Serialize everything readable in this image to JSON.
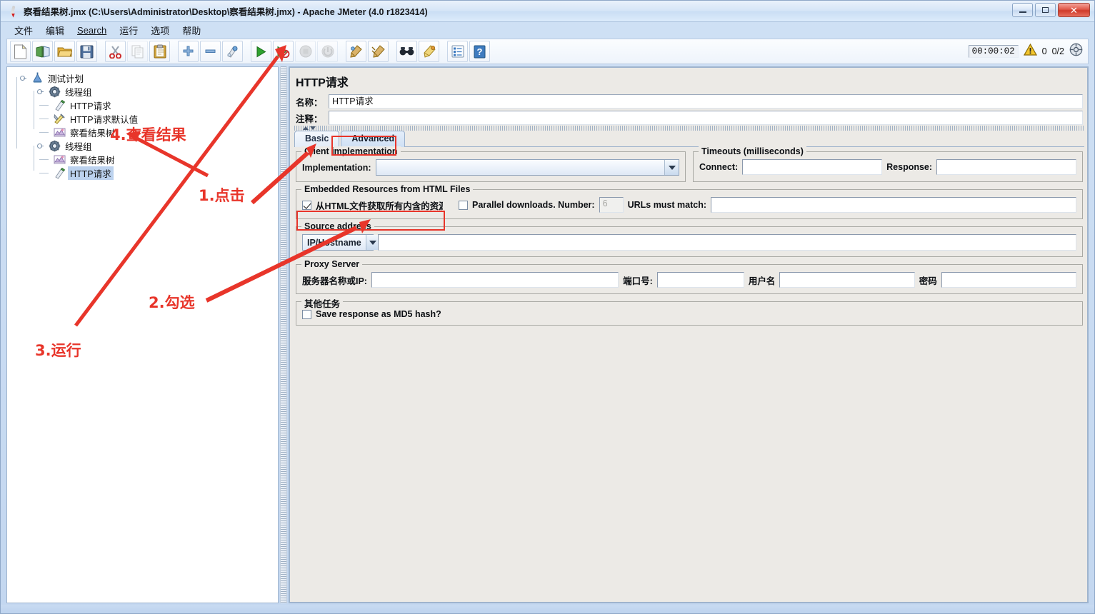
{
  "window": {
    "title": "察看结果树.jmx (C:\\Users\\Administrator\\Desktop\\察看结果树.jmx) - Apache JMeter (4.0 r1823414)",
    "icon": "jmeter-feather-icon",
    "controls": {
      "minimize": "–",
      "maximize": "□",
      "close": "✕"
    }
  },
  "menubar": {
    "items": [
      {
        "label": "文件",
        "name": "menu-file"
      },
      {
        "label": "编辑",
        "name": "menu-edit"
      },
      {
        "label": "Search",
        "name": "menu-search"
      },
      {
        "label": "运行",
        "name": "menu-run"
      },
      {
        "label": "选项",
        "name": "menu-options"
      },
      {
        "label": "帮助",
        "name": "menu-help"
      }
    ]
  },
  "toolbar": {
    "buttons": [
      {
        "name": "new-icon",
        "title": "新建"
      },
      {
        "name": "templates-icon",
        "title": "模板"
      },
      {
        "name": "open-icon",
        "title": "打开"
      },
      {
        "name": "save-icon",
        "title": "保存"
      },
      {
        "name": "cut-icon",
        "title": "剪切"
      },
      {
        "name": "copy-icon",
        "title": "复制"
      },
      {
        "name": "paste-icon",
        "title": "粘贴"
      },
      {
        "name": "expand-icon",
        "title": "展开"
      },
      {
        "name": "collapse-icon",
        "title": "折叠"
      },
      {
        "name": "toggle-icon",
        "title": "启用/禁用"
      },
      {
        "name": "start-icon",
        "title": "启动"
      },
      {
        "name": "start-no-pauses-icon",
        "title": "无间隔启动"
      },
      {
        "name": "stop-icon",
        "title": "停止"
      },
      {
        "name": "shutdown-icon",
        "title": "关闭"
      },
      {
        "name": "clear-icon",
        "title": "清除"
      },
      {
        "name": "clear-all-icon",
        "title": "清除全部"
      },
      {
        "name": "search-icon",
        "title": "查找"
      },
      {
        "name": "reset-search-icon",
        "title": "重置查找"
      },
      {
        "name": "function-helper-icon",
        "title": "函数助手"
      },
      {
        "name": "help-icon",
        "title": "帮助"
      }
    ],
    "status": {
      "elapsed": "00:00:02",
      "warning_icon": "warning-triangle-icon",
      "error_count": "0",
      "threads": "0/2",
      "remote_icon": "remote-connect-icon"
    }
  },
  "tree": {
    "nodes": [
      {
        "label": "测试计划",
        "icon": "test-plan-icon",
        "depth": 0,
        "selected": false,
        "expander": true
      },
      {
        "label": "线程组",
        "icon": "thread-group-icon",
        "depth": 1,
        "selected": false,
        "expander": true
      },
      {
        "label": "HTTP请求",
        "icon": "http-request-icon",
        "depth": 2,
        "selected": false,
        "expander": false
      },
      {
        "label": "HTTP请求默认值",
        "icon": "http-defaults-icon",
        "depth": 2,
        "selected": false,
        "expander": false
      },
      {
        "label": "察看结果树",
        "icon": "view-results-tree-icon",
        "depth": 2,
        "selected": false,
        "expander": false
      },
      {
        "label": "线程组",
        "icon": "thread-group-icon",
        "depth": 1,
        "selected": false,
        "expander": true
      },
      {
        "label": "察看结果树",
        "icon": "view-results-tree-icon",
        "depth": 2,
        "selected": false,
        "expander": false
      },
      {
        "label": "HTTP请求",
        "icon": "http-request-icon",
        "depth": 2,
        "selected": true,
        "expander": false
      }
    ]
  },
  "main": {
    "panel_title": "HTTP请求",
    "name_label": "名称：",
    "name_value": "HTTP请求",
    "comment_label": "注释：",
    "comment_value": "",
    "tabs": [
      {
        "label": "Basic",
        "active": false,
        "name": "tab-basic"
      },
      {
        "label": "Advanced",
        "active": true,
        "name": "tab-advanced"
      }
    ],
    "client_implementation": {
      "legend": "Client implementation",
      "impl_label": "Implementation:",
      "impl_value": ""
    },
    "timeouts": {
      "legend": "Timeouts (milliseconds)",
      "connect_label": "Connect:",
      "connect_value": "",
      "response_label": "Response:",
      "response_value": ""
    },
    "embedded": {
      "legend": "Embedded Resources from HTML Files",
      "retrieve_label": "从HTML文件获取所有内含的资源",
      "retrieve_checked": true,
      "parallel_label": "Parallel downloads. Number:",
      "parallel_checked": false,
      "parallel_number": "6",
      "urls_label": "URLs must match:",
      "urls_value": ""
    },
    "source_address": {
      "legend": "Source address",
      "type_value": "IP/Hostname",
      "address_value": ""
    },
    "proxy": {
      "legend": "Proxy Server",
      "server_label": "服务器名称或IP:",
      "server_value": "",
      "port_label": "端口号:",
      "port_value": "",
      "user_label": "用户名",
      "user_value": "",
      "pass_label": "密码",
      "pass_value": ""
    },
    "other_tasks": {
      "legend": "其他任务",
      "md5_label": "Save response as MD5 hash?",
      "md5_checked": false
    }
  },
  "annotations": {
    "color": "#e8352a",
    "items": [
      {
        "text": "1.点击",
        "name": "annotation-click"
      },
      {
        "text": "2.勾选",
        "name": "annotation-check"
      },
      {
        "text": "3.运行",
        "name": "annotation-run"
      },
      {
        "text": "4.查看结果",
        "name": "annotation-view-results"
      }
    ]
  }
}
